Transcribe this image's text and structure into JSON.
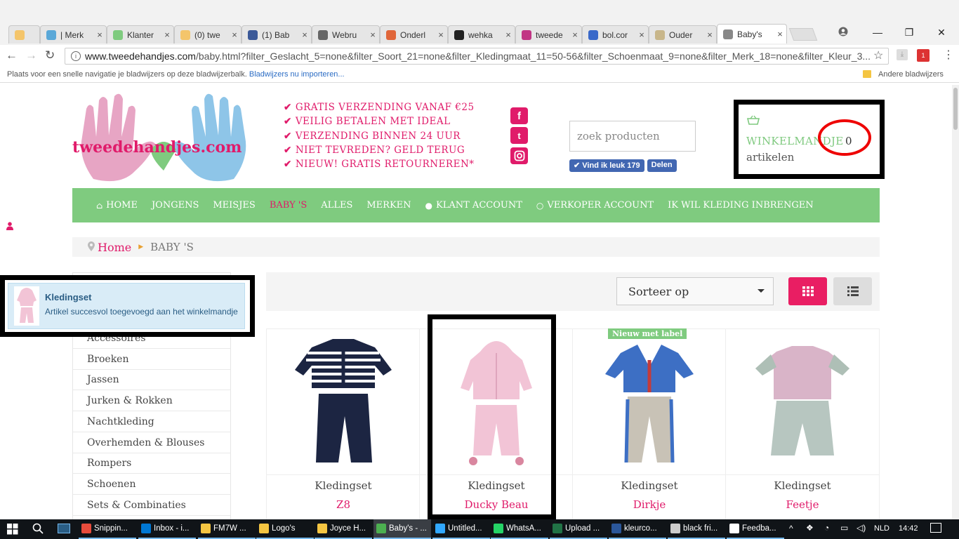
{
  "browser": {
    "tabs": [
      {
        "label": "",
        "icon": "smiley-icon",
        "color": "#f4c56b"
      },
      {
        "label": "| Merk",
        "icon": "tshirt-icon",
        "color": "#5aa8d8"
      },
      {
        "label": "Klanter",
        "icon": "tshirt-icon",
        "color": "#7fcb7f"
      },
      {
        "label": "(0) twe",
        "icon": "smiley-icon",
        "color": "#f4c56b"
      },
      {
        "label": "(1) Bab",
        "icon": "facebook-icon",
        "color": "#3b5998"
      },
      {
        "label": "Webru",
        "icon": "circle-icon",
        "color": "#666666"
      },
      {
        "label": "Onderl",
        "icon": "joomla-icon",
        "color": "#e0663a"
      },
      {
        "label": "wehka",
        "icon": "w-icon",
        "color": "#222222"
      },
      {
        "label": "tweede",
        "icon": "instagram-icon",
        "color": "#c13584"
      },
      {
        "label": "bol.cor",
        "icon": "bol-icon",
        "color": "#3a69c9"
      },
      {
        "label": "Ouder",
        "icon": "page-icon",
        "color": "#c8b68a"
      },
      {
        "label": "Baby's",
        "icon": "page-icon",
        "color": "#888888",
        "active": true
      }
    ],
    "url_prefix": "www.tweedehandjes.com",
    "url_path": "/baby.html?filter_Geslacht_5=none&filter_Soort_21=none&filter_Kledingmaat_11=50-56&filter_Schoenmaat_9=none&filter_Merk_18=none&filter_Kleur_3...",
    "bookmarks_text": "Plaats voor een snelle navigatie je bladwijzers op deze bladwijzerbalk.",
    "bookmarks_link": "Bladwijzers nu importeren...",
    "other_bookmarks": "Andere bladwijzers"
  },
  "site": {
    "logo_text": "tweedehandjes.com",
    "usps": [
      "GRATIS VERZENDING VANAF €25",
      "VEILIG BETALEN MET IDEAL",
      "VERZENDING BINNEN 24 UUR",
      "NIET TEVREDEN? GELD TERUG",
      "NIEUW! GRATIS RETOURNEREN*"
    ],
    "search_placeholder": "zoek producten",
    "fb_like": "Vind ik leuk 179",
    "fb_share": "Delen",
    "cart": {
      "label": "WINKELMANDJE",
      "count": "0",
      "unit": "artikelen"
    },
    "nav": [
      {
        "label": "HOME",
        "icon": "home-icon"
      },
      {
        "label": "JONGENS"
      },
      {
        "label": "MEISJES"
      },
      {
        "label": "BABY 'S",
        "active": true
      },
      {
        "label": "ALLES"
      },
      {
        "label": "MERKEN"
      },
      {
        "label": "KLANT ACCOUNT",
        "icon": "user-icon"
      },
      {
        "label": "VERKOPER ACCOUNT",
        "icon": "user-outline-icon"
      },
      {
        "label": "IK WIL KLEDING INBRENGEN"
      }
    ],
    "breadcrumb": {
      "home": "Home",
      "current": "BABY 'S"
    },
    "categories": [
      "Accessoires",
      "Broeken",
      "Jassen",
      "Jurken & Rokken",
      "Nachtkleding",
      "Overhemden & Blouses",
      "Rompers",
      "Schoenen",
      "Sets & Combinaties"
    ],
    "toast": {
      "title": "Kledingset",
      "message": "Artikel succesvol toegevoegd aan het winkelmandje"
    },
    "sort_label": "Sorteer op",
    "new_label": "Nieuw met label",
    "products": [
      {
        "name": "Kledingset",
        "brand": "Z8"
      },
      {
        "name": "Kledingset",
        "brand": "Ducky Beau"
      },
      {
        "name": "Kledingset",
        "brand": "Dirkje"
      },
      {
        "name": "Kledingset",
        "brand": "Feetje"
      }
    ]
  },
  "taskbar": {
    "apps": [
      {
        "label": "Snippin...",
        "color": "#e74c3c"
      },
      {
        "label": "Inbox - i...",
        "color": "#0078d4"
      },
      {
        "label": "FM7W ...",
        "color": "#f4c542"
      },
      {
        "label": "Logo's",
        "color": "#f4c542"
      },
      {
        "label": "Joyce H...",
        "color": "#f4c542"
      },
      {
        "label": "Baby's - ...",
        "color": "#4caf50"
      },
      {
        "label": "Untitled...",
        "color": "#31a8ff"
      },
      {
        "label": "WhatsA...",
        "color": "#25d366"
      },
      {
        "label": "Upload ...",
        "color": "#217346"
      },
      {
        "label": "kleurco...",
        "color": "#2b579a"
      },
      {
        "label": "black fri...",
        "color": "#cccccc"
      },
      {
        "label": "Feedba...",
        "color": "#ffffff"
      }
    ],
    "lang": "NLD",
    "time": "14:42"
  }
}
